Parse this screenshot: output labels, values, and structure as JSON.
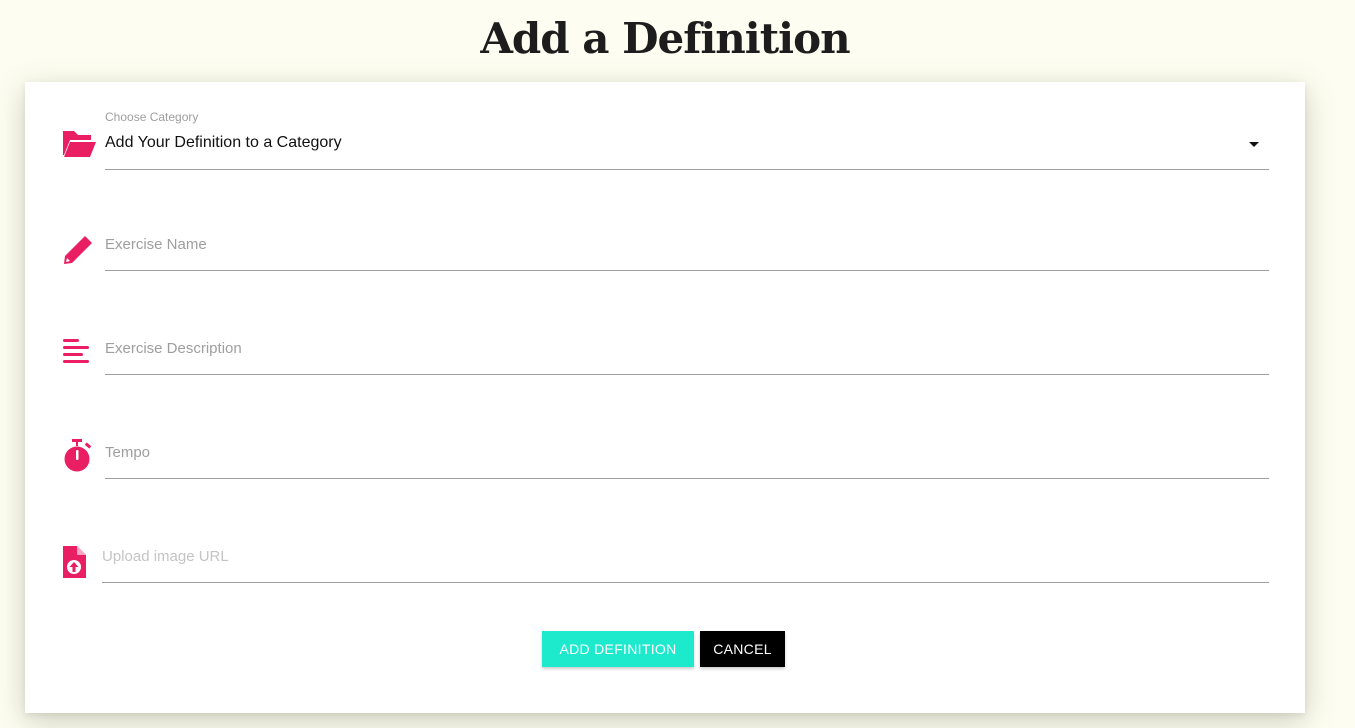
{
  "page": {
    "title": "Add a Definition"
  },
  "form": {
    "category": {
      "label": "Choose Category",
      "selected": "Add Your Definition to a Category",
      "icon": "folder-open-icon"
    },
    "exercise_name": {
      "placeholder": "Exercise Name",
      "value": "",
      "icon": "pencil-icon"
    },
    "exercise_description": {
      "placeholder": "Exercise Description",
      "value": "",
      "icon": "text-lines-icon"
    },
    "tempo": {
      "placeholder": "Tempo",
      "value": "",
      "icon": "stopwatch-icon"
    },
    "image_url": {
      "placeholder": "Upload image URL",
      "value": "",
      "icon": "file-upload-icon"
    }
  },
  "buttons": {
    "add": "ADD DEFINITION",
    "cancel": "CANCEL"
  },
  "colors": {
    "accent": "#e91e63",
    "primary_button": "#1de9cc",
    "secondary_button": "#000000",
    "background": "#fdfdf1"
  }
}
